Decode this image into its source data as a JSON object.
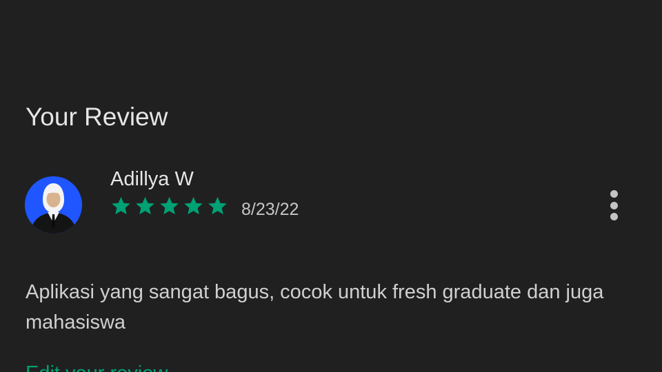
{
  "section": {
    "title": "Your Review"
  },
  "review": {
    "reviewer_name": "Adillya W",
    "rating": 5,
    "rating_max": 5,
    "date": "8/23/22",
    "text": "Aplikasi yang sangat bagus, cocok untuk fresh graduate dan juga mahasiswa",
    "star_color": "#00a173",
    "avatar_bg": "#1f56ff"
  },
  "actions": {
    "more_icon": "more-vert-icon",
    "edit_label": "Edit your review"
  }
}
